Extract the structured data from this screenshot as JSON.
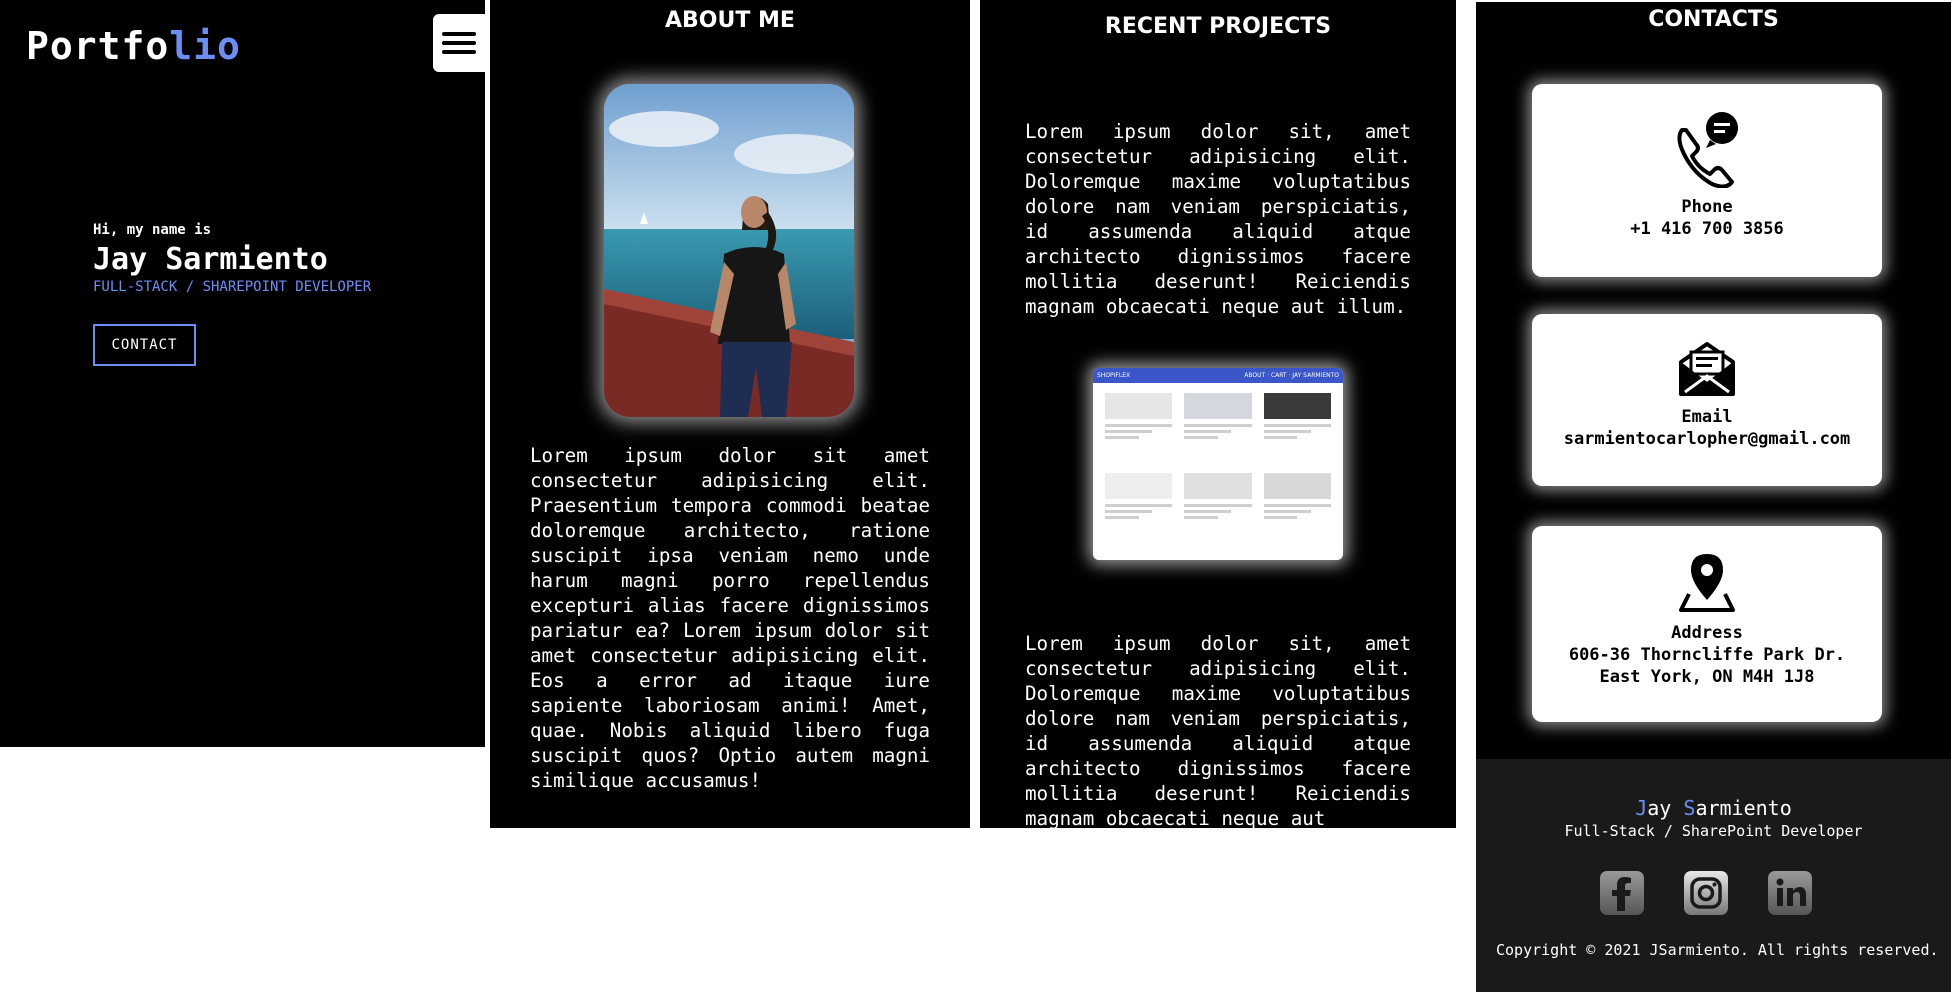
{
  "hero": {
    "logo_main": "Portfo",
    "logo_accent": "lio",
    "greeting": "Hi, my name is",
    "name": "Jay Sarmiento",
    "role": "FULL-STACK / SHAREPOINT DEVELOPER",
    "contact_label": "CONTACT"
  },
  "about": {
    "title": "ABOUT ME",
    "text": "Lorem ipsum dolor sit amet consectetur adipisicing elit. Praesentium tempora commodi beatae doloremque architecto, ratione suscipit ipsa veniam nemo unde harum magni porro repellendus excepturi alias facere dignissimos pariatur ea? Lorem ipsum dolor sit amet consectetur adipisicing elit. Eos a error ad itaque iure sapiente laboriosam animi! Amet, quae. Nobis aliquid libero fuga suscipit quos? Optio autem magni similique accusamus!"
  },
  "projects": {
    "title": "RECENT PROJECTS",
    "text1": "Lorem ipsum dolor sit, amet consectetur adipisicing elit. Doloremque maxime voluptatibus dolore nam veniam perspiciatis, id assumenda aliquid atque architecto dignissimos facere mollitia deserunt! Reiciendis magnam obcaecati neque aut illum.",
    "text2": "Lorem ipsum dolor sit, amet consectetur adipisicing elit. Doloremque maxime voluptatibus dolore nam veniam perspiciatis, id assumenda aliquid atque architecto dignissimos facere mollitia deserunt! Reiciendis magnam obcaecati neque aut",
    "shot_brand": "SHOPIFLEX",
    "shot_nav": "ABOUT · CART · JAY SARMIENTO"
  },
  "contacts": {
    "title": "CONTACTS",
    "cards": [
      {
        "label": "Phone",
        "value": "+1 416 700 3856"
      },
      {
        "label": "Email",
        "value": "sarmientocarlopher@gmail.com"
      },
      {
        "label": "Address",
        "value": "606-36 Thorncliffe Park Dr.",
        "value2": "East York, ON M4H 1J8"
      }
    ]
  },
  "footer": {
    "name_first_initial": "J",
    "name_first_rest": "ay ",
    "name_last_initial": "S",
    "name_last_rest": "armiento",
    "role": "Full-Stack / SharePoint Developer",
    "copyright": "Copyright © 2021 JSarmiento. All rights reserved.",
    "socials": [
      "facebook-icon",
      "instagram-icon",
      "linkedin-icon"
    ]
  },
  "colors": {
    "accent": "#6b8ef5",
    "panel": "#000000"
  }
}
